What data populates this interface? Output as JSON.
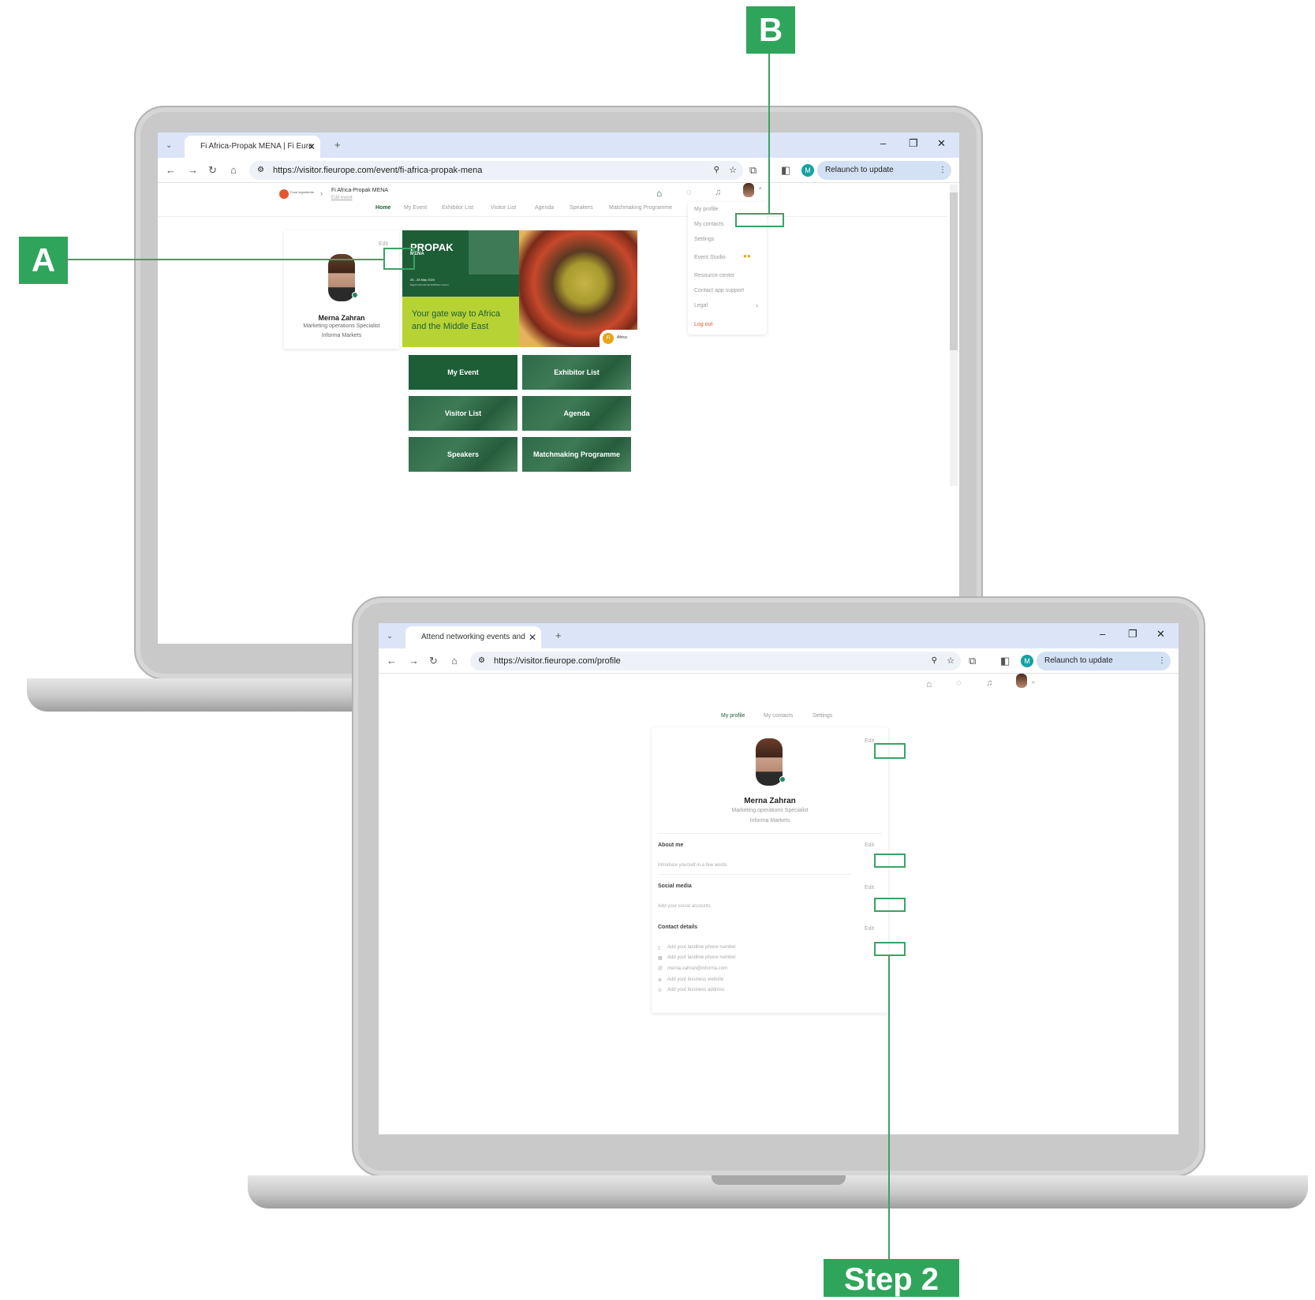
{
  "callouts": {
    "a": "A",
    "b": "B",
    "step": "Step 2"
  },
  "window1": {
    "tab_title": "Fi Africa-Propak MENA | Fi Euro",
    "url": "https://visitor.fieurope.com/event/fi-africa-propak-mena",
    "relaunch": "Relaunch to update",
    "profile_initial": "M",
    "brand": {
      "logo_text": "Food ingredients",
      "event_name": "Fi Africa-Propak MENA",
      "edit_event": "Edit event"
    },
    "nav": [
      "Home",
      "My Event",
      "Exhibitor List",
      "Visitor List",
      "Agenda",
      "Speakers",
      "Matchmaking Programme"
    ],
    "profile_card": {
      "edit": "Edit",
      "name": "Merna Zahran",
      "role": "Marketing operations Specialist",
      "company": "Informa Markets"
    },
    "banner": {
      "brand": "PROPAK",
      "brand_sub": "MENA",
      "dates": "26 - 28 May 2024",
      "venue": "Egypt International Exhibition Center",
      "headline1": "Your gate way to Africa",
      "headline2": "and the Middle East",
      "badge": "Fi",
      "badge_text": "Africa"
    },
    "tiles": [
      "My Event",
      "Exhibitor List",
      "Visitor List",
      "Agenda",
      "Speakers",
      "Matchmaking Programme"
    ],
    "menu": [
      "My profile",
      "My contacts",
      "Settings",
      "Event Studio",
      "Resource center",
      "Contact app support",
      "Legal",
      "Log out"
    ]
  },
  "window2": {
    "tab_title": "Attend networking events and",
    "url": "https://visitor.fieurope.com/profile",
    "relaunch": "Relaunch to update",
    "profile_initial": "M",
    "tabs": [
      "My profile",
      "My contacts",
      "Settings"
    ],
    "profile": {
      "edit": "Edit",
      "name": "Merna Zahran",
      "role": "Marketing operations Specialist",
      "company": "Informa Markets"
    },
    "about": {
      "title": "About me",
      "edit": "Edit",
      "placeholder": "Introduce yourself in a few words"
    },
    "social": {
      "title": "Social media",
      "edit": "Edit",
      "placeholder": "Add your social accounts"
    },
    "contact": {
      "title": "Contact details",
      "edit": "Edit",
      "items": [
        "Add your landline phone number",
        "Add your landline phone number",
        "merna.zahran@informa.com",
        "Add your business website",
        "Add your business address"
      ]
    }
  },
  "colors": {
    "accent": "#2fa55b",
    "brand_green": "#1d5e37",
    "tab_bar": "#dbe5f7"
  }
}
